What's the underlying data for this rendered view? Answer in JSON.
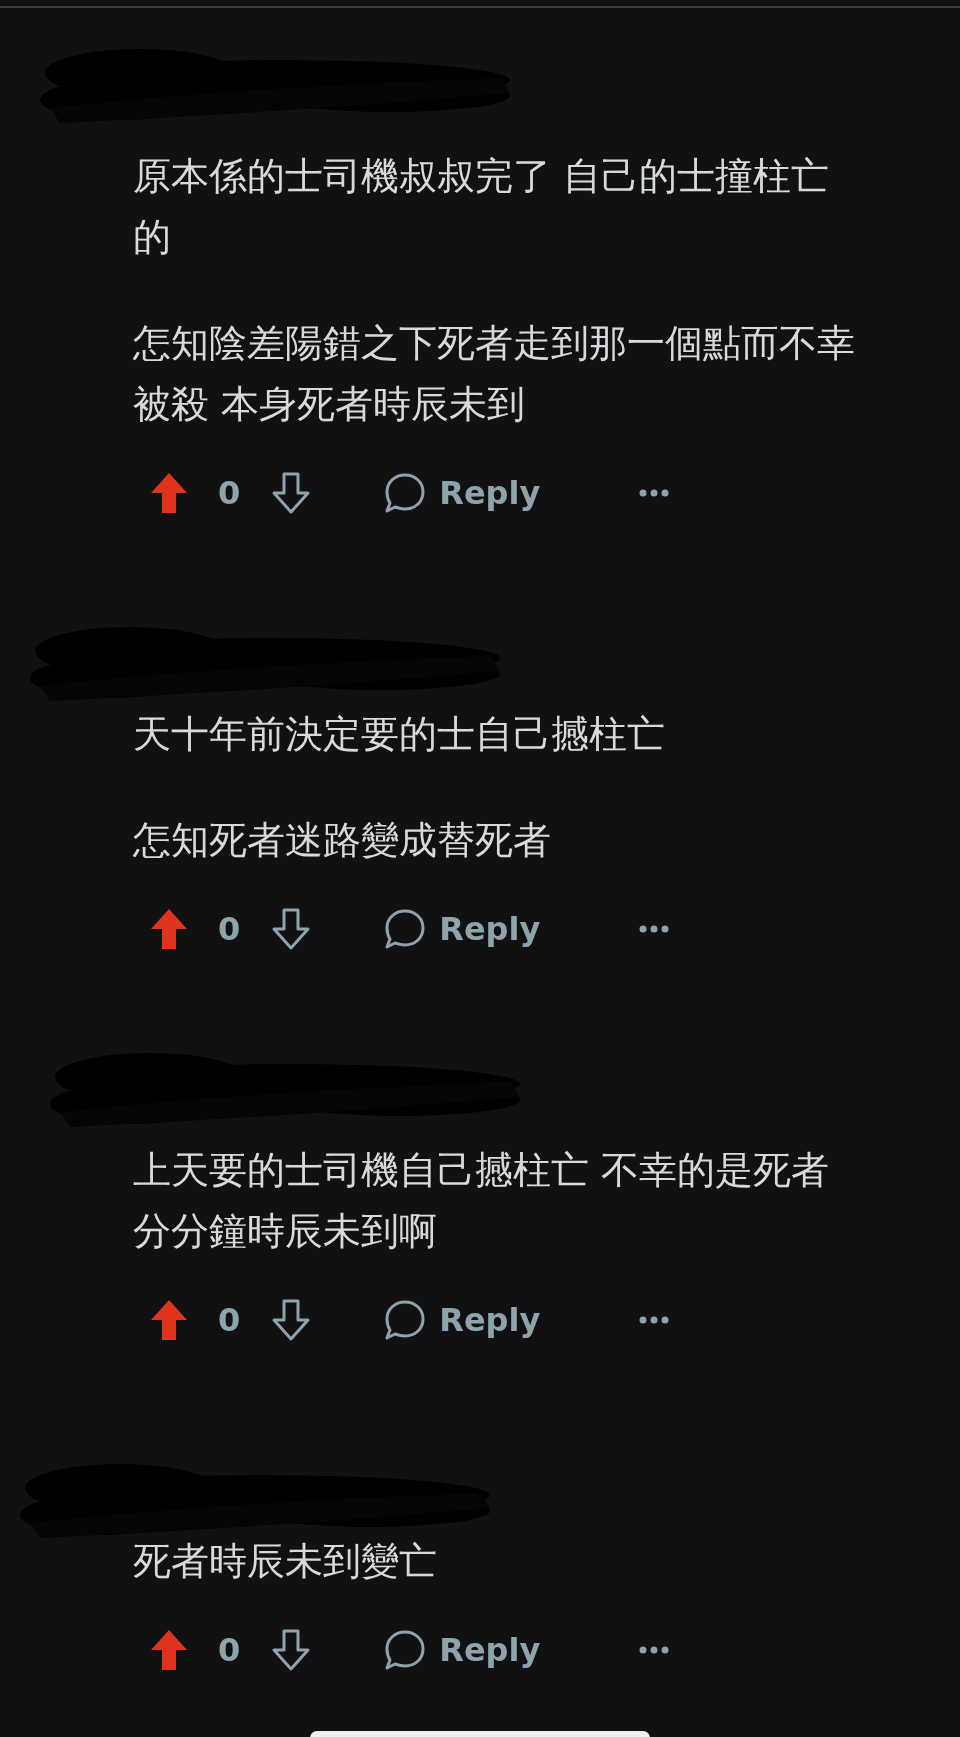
{
  "comments": [
    {
      "author": {
        "redacted": true
      },
      "paragraphs": [
        "原本係的士司機叔叔完了 自己的士撞柱亡的",
        "怎知陰差陽錯之下死者走到那一個點而不幸被殺 本身死者時辰未到"
      ],
      "upvoted": true,
      "score": "0",
      "reply_label": "Reply"
    },
    {
      "author": {
        "redacted": true
      },
      "paragraphs": [
        "天十年前決定要的士自己撼柱亡",
        "怎知死者迷路變成替死者"
      ],
      "upvoted": true,
      "score": "0",
      "reply_label": "Reply"
    },
    {
      "author": {
        "redacted": true
      },
      "paragraphs": [
        "上天要的士司機自己撼柱亡 不幸的是死者分分鐘時辰未到啊"
      ],
      "upvoted": true,
      "score": "0",
      "reply_label": "Reply"
    },
    {
      "author": {
        "redacted": true
      },
      "paragraphs": [
        "死者時辰未到變亡"
      ],
      "upvoted": true,
      "score": "0",
      "reply_label": "Reply"
    }
  ]
}
